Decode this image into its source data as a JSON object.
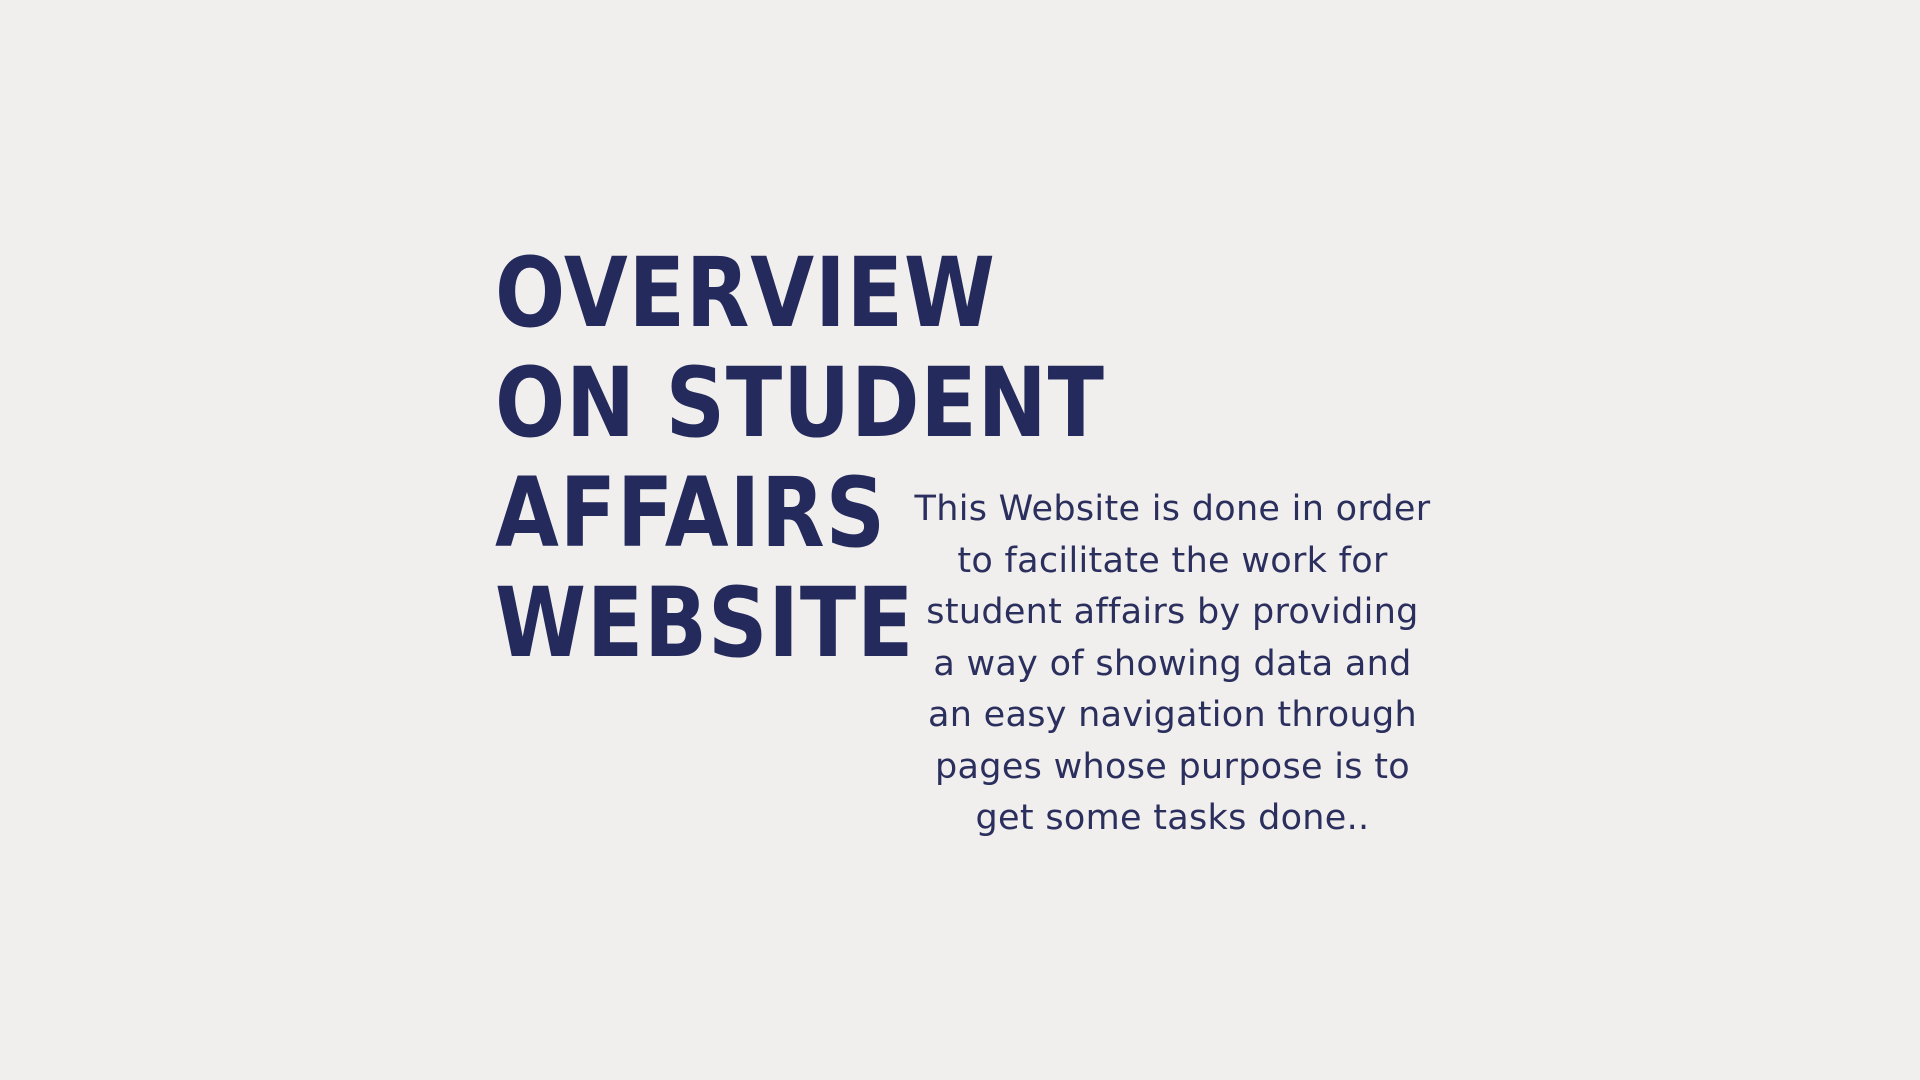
{
  "title": {
    "lines": [
      "OVERVIEW",
      "ON STUDENT",
      "AFFAIRS",
      "WEBSITE"
    ]
  },
  "description": {
    "lines": [
      "This Website is done in order",
      "to facilitate the work for",
      "student affairs by providing",
      "a way of showing data and",
      "an easy navigation through",
      "pages whose purpose is to",
      "get some tasks done.."
    ]
  },
  "colors": {
    "background": "#f1efed",
    "title": "#252a5d",
    "text": "#2b2f5d"
  }
}
